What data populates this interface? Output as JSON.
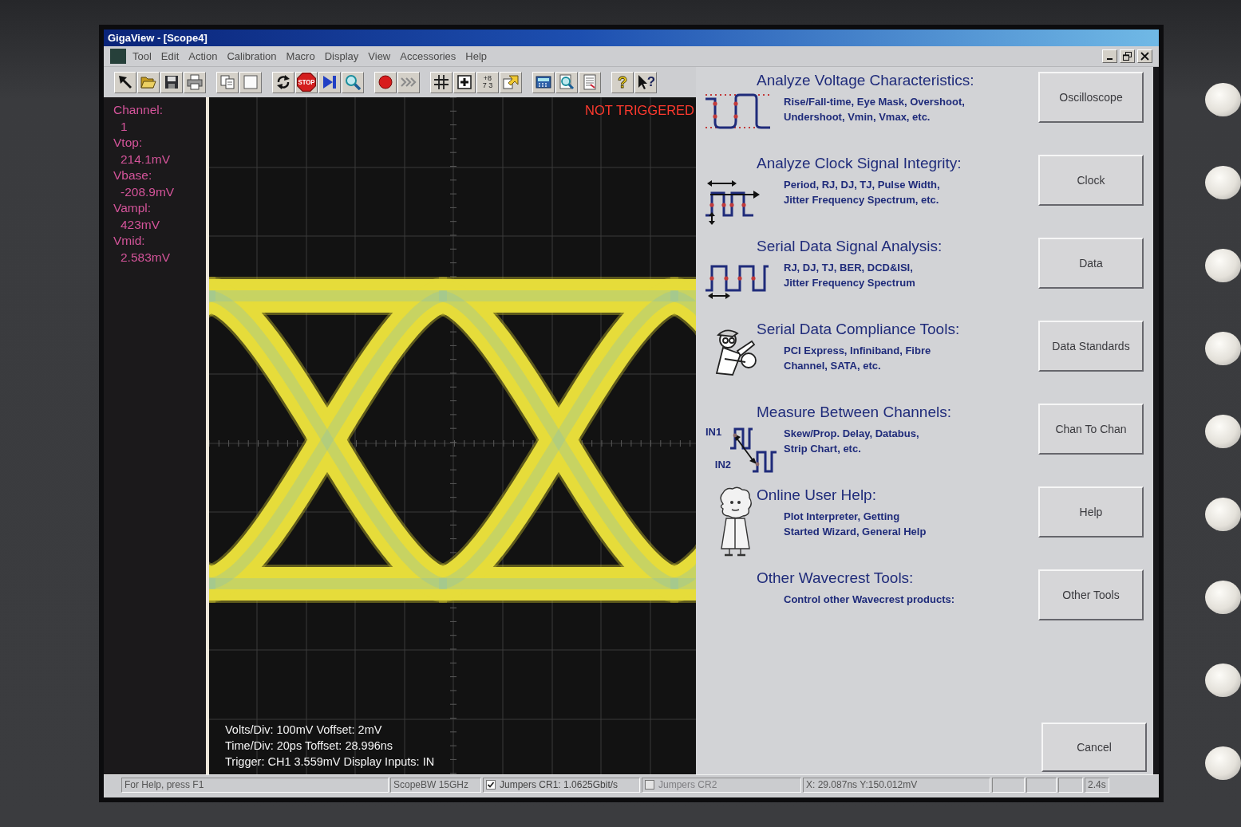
{
  "window": {
    "title": "GigaView - [Scope4]"
  },
  "menu": [
    "Tool",
    "Edit",
    "Action",
    "Calibration",
    "Macro",
    "Display",
    "View",
    "Accessories",
    "Help"
  ],
  "toolbar": [
    [
      {
        "kind": "arrow"
      },
      {
        "kind": "open"
      },
      {
        "kind": "save"
      },
      {
        "kind": "print"
      }
    ],
    [
      {
        "kind": "copy"
      },
      {
        "kind": "blank"
      }
    ],
    [
      {
        "kind": "refresh"
      },
      {
        "kind": "stop",
        "text": "STOP"
      },
      {
        "kind": "skip"
      },
      {
        "kind": "zoom"
      }
    ],
    [
      {
        "kind": "record"
      },
      {
        "kind": "chevrons"
      }
    ],
    [
      {
        "kind": "grid"
      },
      {
        "kind": "plusbox"
      },
      {
        "kind": "digits",
        "lines": [
          "+8",
          "7 3"
        ]
      },
      {
        "kind": "cursorbox"
      }
    ],
    [
      {
        "kind": "calculator"
      },
      {
        "kind": "pagesearch"
      },
      {
        "kind": "notepad"
      }
    ],
    [
      {
        "kind": "help",
        "text": "?"
      },
      {
        "kind": "pointerhelp",
        "text": "?"
      }
    ]
  ],
  "measurements": [
    {
      "label": "Channel:",
      "value": "1"
    },
    {
      "label": "Vtop:",
      "value": "214.1mV"
    },
    {
      "label": "Vbase:",
      "value": "-208.9mV"
    },
    {
      "label": "Vampl:",
      "value": "423mV"
    },
    {
      "label": "Vmid:",
      "value": "2.583mV"
    }
  ],
  "plot": {
    "trigger_status": "NOT TRIGGERED",
    "info_lines": [
      "Volts/Div: 100mV Voffset: 2mV",
      "Time/Div: 20ps Toffset: 28.996ns",
      "Trigger: CH1 3.559mV Display Inputs: IN"
    ]
  },
  "analysis_panel": {
    "sections": [
      {
        "kind": "voltage",
        "title": "Analyze Voltage Characteristics:",
        "description": [
          "Rise/Fall-time, Eye Mask, Overshoot,",
          "Undershoot, Vmin, Vmax, etc."
        ],
        "button": "Oscilloscope"
      },
      {
        "kind": "clock",
        "title": "Analyze Clock Signal Integrity:",
        "description": [
          "Period, RJ, DJ, TJ, Pulse Width,",
          "Jitter Frequency Spectrum, etc."
        ],
        "button": "Clock"
      },
      {
        "kind": "data",
        "title": "Serial Data Signal Analysis:",
        "description": [
          "RJ, DJ, TJ, BER, DCD&ISI,",
          "Jitter Frequency Spectrum"
        ],
        "button": "Data"
      },
      {
        "kind": "compliance",
        "title": "Serial Data Compliance Tools:",
        "description": [
          "PCI Express, Infiniband, Fibre",
          "Channel, SATA, etc."
        ],
        "button": "Data Standards"
      },
      {
        "kind": "channels",
        "channel_labels": [
          "IN1",
          "IN2"
        ],
        "title": "Measure Between Channels:",
        "description": [
          "Skew/Prop. Delay, Databus,",
          "Strip Chart, etc."
        ],
        "button": "Chan To Chan"
      },
      {
        "kind": "help",
        "title": "Online User Help:",
        "description": [
          "Plot Interpreter, Getting",
          "Started Wizard, General Help"
        ],
        "button": "Help"
      },
      {
        "kind": "tools",
        "title": "Other Wavecrest Tools:",
        "description": [
          "Control other Wavecrest products:"
        ],
        "button": "Other Tools"
      }
    ],
    "cancel": "Cancel"
  },
  "status_bar": {
    "panels": [
      {
        "kind": "text",
        "text": "For Help, press F1"
      },
      {
        "kind": "text",
        "text": "ScopeBW 15GHz"
      },
      {
        "kind": "checkbox",
        "label": "Jumpers CR1: 1.0625Gbit/s",
        "checked": true,
        "disabled": false
      },
      {
        "kind": "checkbox",
        "label": "Jumpers CR2",
        "checked": false,
        "disabled": true
      },
      {
        "kind": "text",
        "text": "X: 29.087ns Y:150.012mV"
      },
      {
        "kind": "empty"
      },
      {
        "kind": "empty"
      },
      {
        "kind": "empty"
      },
      {
        "kind": "text",
        "text": "2.4s"
      }
    ]
  }
}
